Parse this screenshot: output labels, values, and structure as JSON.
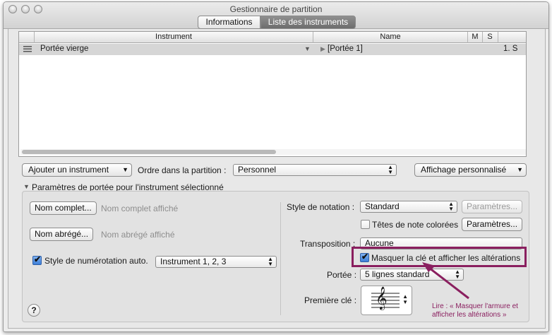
{
  "window": {
    "title": "Gestionnaire de partition"
  },
  "tabs": [
    {
      "label": "Informations"
    },
    {
      "label": "Liste des instruments"
    }
  ],
  "table": {
    "headers": {
      "instrument": "Instrument",
      "name": "Name",
      "m": "M",
      "s": "S"
    },
    "rows": [
      {
        "instrument": "Portée vierge",
        "name": "[Portée 1]",
        "s": "1. S"
      }
    ]
  },
  "controls": {
    "add_instrument": "Ajouter un instrument",
    "order_label": "Ordre dans la partition :",
    "order_value": "Personnel",
    "display_value": "Affichage personnalisé"
  },
  "params": {
    "section_title": "Paramètres de portée pour l'instrument sélectionné",
    "full_name_button": "Nom complet...",
    "full_name_placeholder": "Nom complet affiché",
    "short_name_button": "Nom abrégé...",
    "short_name_placeholder": "Nom abrégé affiché",
    "auto_number_label": "Style de numérotation auto.",
    "auto_number_value": "Instrument 1, 2, 3",
    "notation_style_label": "Style de notation :",
    "notation_style_value": "Standard",
    "notation_params_button": "Paramètres...",
    "colored_heads_label": "Têtes de note colorées",
    "colored_heads_button": "Paramètres...",
    "transposition_label": "Transposition :",
    "transposition_value": "Aucune",
    "hide_key_label": "Masquer la clé et afficher les altérations",
    "staff_label": "Portée :",
    "staff_value": "5 lignes standard",
    "first_clef_label": "Première clé :",
    "clef_glyph": "𝄞"
  },
  "annotation": {
    "line1": "Lire : « Masquer l'armure et",
    "line2": "afficher les altérations »"
  },
  "colors": {
    "annotation": "#8a1f5f",
    "checkbox_on": "#3d7fd8"
  }
}
